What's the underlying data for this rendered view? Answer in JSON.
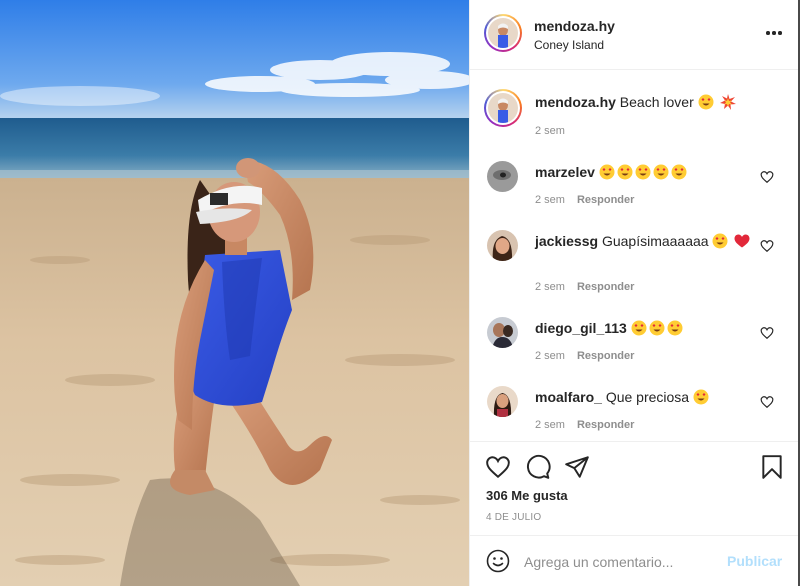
{
  "post": {
    "username": "mendoza.hy",
    "location": "Coney Island",
    "caption_user": "mendoza.hy",
    "caption_text": "Beach lover",
    "caption_time": "2 sem",
    "likes": "306 Me gusta",
    "date": "4 DE JULIO"
  },
  "comments": [
    {
      "user": "marzelev",
      "text": "",
      "time": "2 sem",
      "reply": "Responder"
    },
    {
      "user": "jackiessg",
      "text": "Guapísimaaaaaa",
      "time": "2 sem",
      "reply": "Responder"
    },
    {
      "user": "diego_gil_113",
      "text": "",
      "time": "2 sem",
      "reply": "Responder"
    },
    {
      "user": "moalfaro_",
      "text": "Que preciosa",
      "time": "2 sem",
      "reply": "Responder"
    }
  ],
  "composer": {
    "placeholder": "Agrega un comentario...",
    "publish_label": "Publicar"
  },
  "icons": {
    "more": "more-horizontal-icon",
    "like": "heart-icon",
    "comment": "comment-bubble-icon",
    "share": "paper-plane-icon",
    "save": "bookmark-icon",
    "emoji": "smiley-icon"
  },
  "colors": {
    "text": "#262626",
    "muted": "#8e8e8e",
    "publish_disabled": "#b2dffc",
    "swimsuit": "#2f4fd8"
  }
}
